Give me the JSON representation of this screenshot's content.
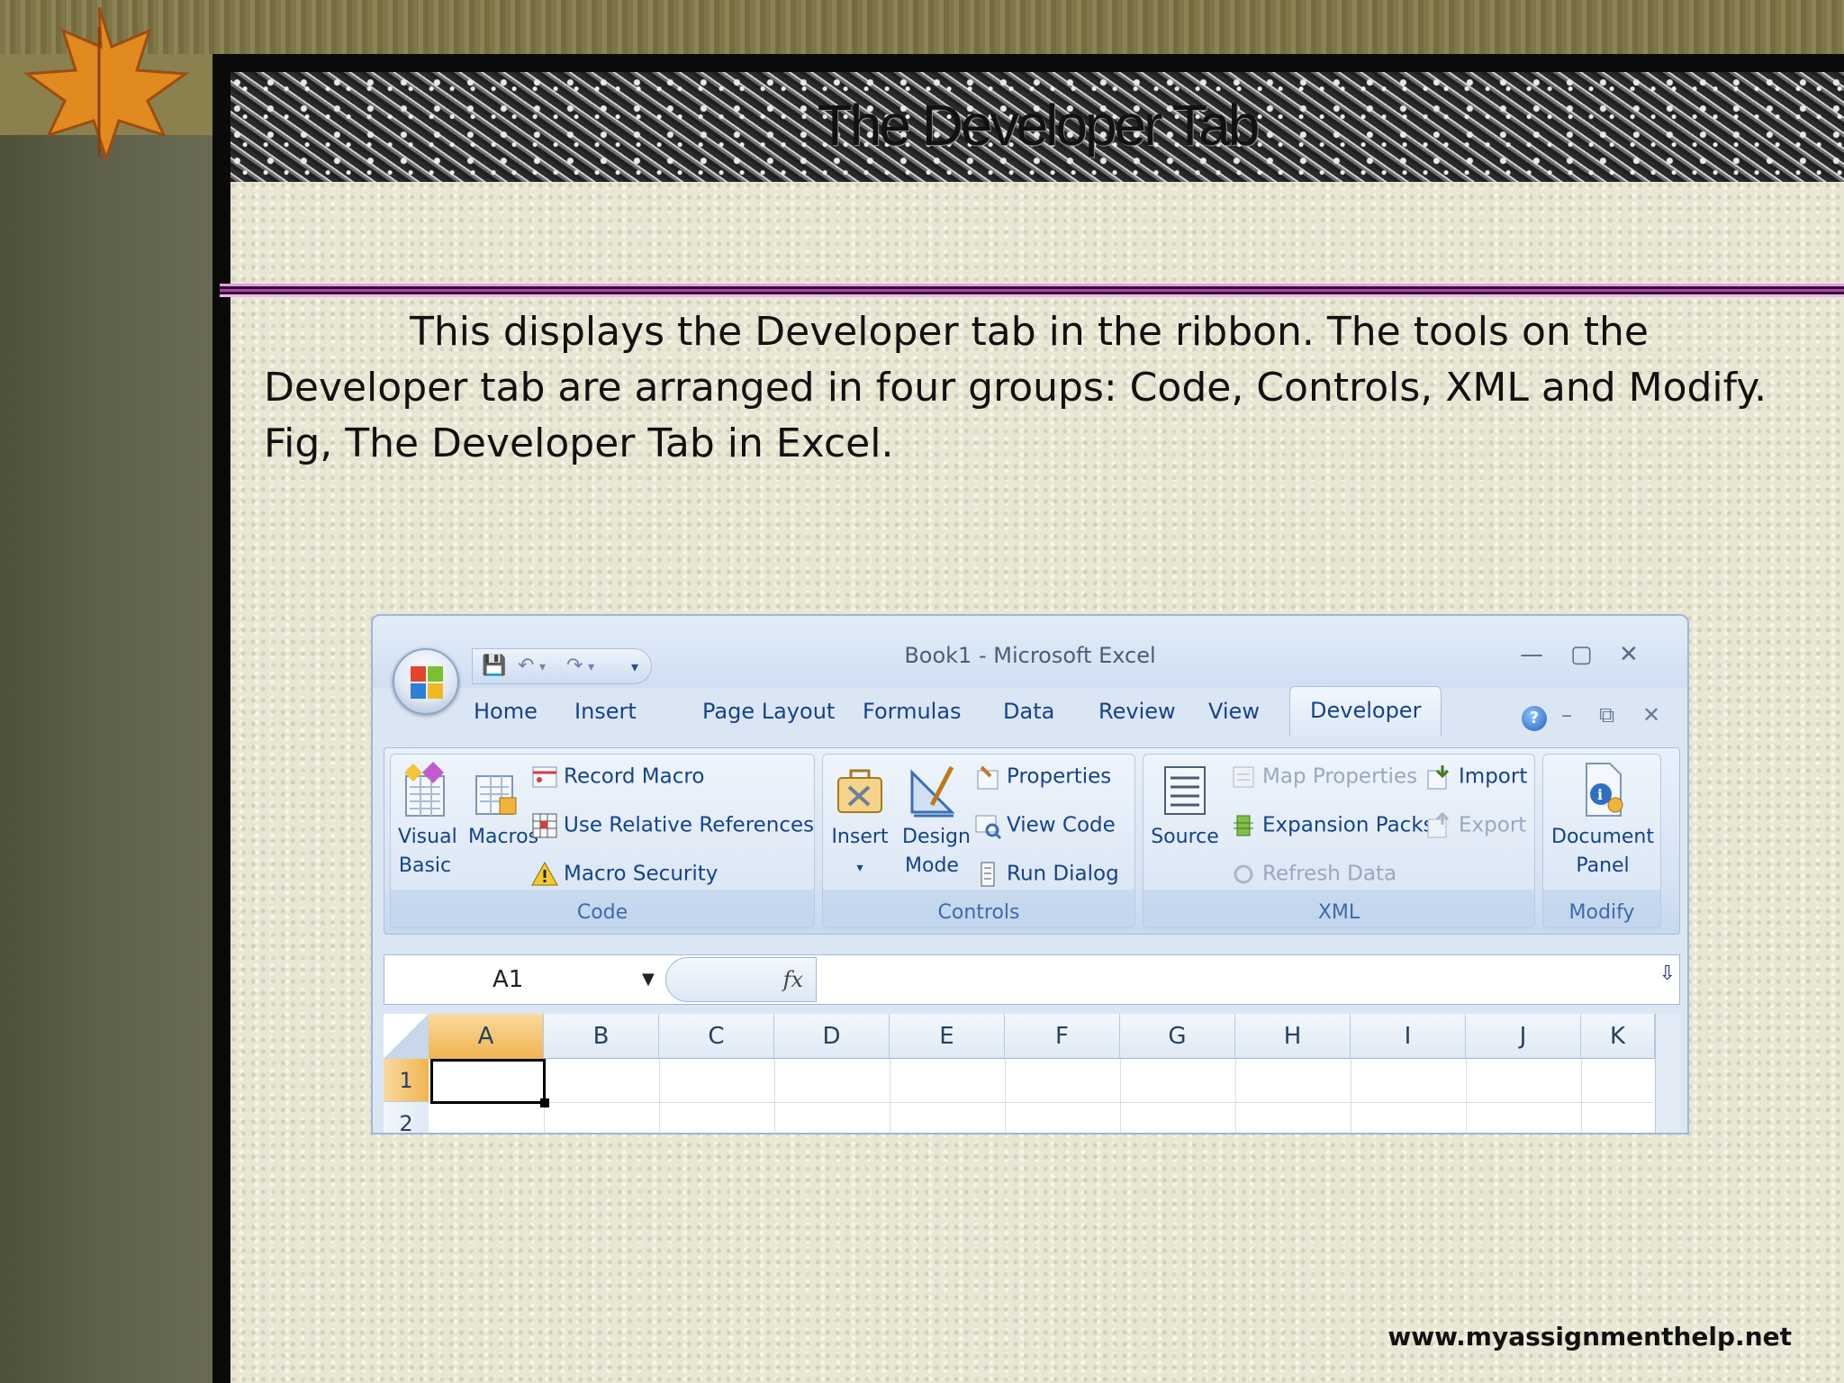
{
  "slide": {
    "title": "The Developer Tab",
    "body": "This displays the Developer tab in the ribbon. The tools on the Developer tab are arranged in four groups: Code, Controls, XML and Modify. Fig, The Developer Tab in Excel.",
    "footer": "www.myassignmenthelp.net"
  },
  "excel": {
    "window_title": "Book1 - Microsoft Excel",
    "tabs": [
      "Home",
      "Insert",
      "Page Layout",
      "Formulas",
      "Data",
      "Review",
      "View",
      "Developer"
    ],
    "active_tab": "Developer",
    "groups": {
      "code": {
        "label": "Code",
        "visual_basic": [
          "Visual",
          "Basic"
        ],
        "macros": "Macros",
        "record_macro": "Record Macro",
        "use_relative_references": "Use Relative References",
        "macro_security": "Macro Security"
      },
      "controls": {
        "label": "Controls",
        "insert": "Insert",
        "design_mode": [
          "Design",
          "Mode"
        ],
        "properties": "Properties",
        "view_code": "View Code",
        "run_dialog": "Run Dialog"
      },
      "xml": {
        "label": "XML",
        "source": "Source",
        "map_properties": "Map Properties",
        "expansion_packs": "Expansion Packs",
        "refresh_data": "Refresh Data",
        "import": "Import",
        "export": "Export"
      },
      "modify": {
        "label": "Modify",
        "document_panel": [
          "Document",
          "Panel"
        ]
      }
    },
    "name_box": "A1",
    "columns": [
      "A",
      "B",
      "C",
      "D",
      "E",
      "F",
      "G",
      "H",
      "I",
      "J",
      "K"
    ],
    "rows": [
      "1",
      "2"
    ],
    "colors": {
      "ribbon_text": "#15428b",
      "selected_header": "#f1b44f",
      "title_rule": "#a24c9e"
    }
  }
}
